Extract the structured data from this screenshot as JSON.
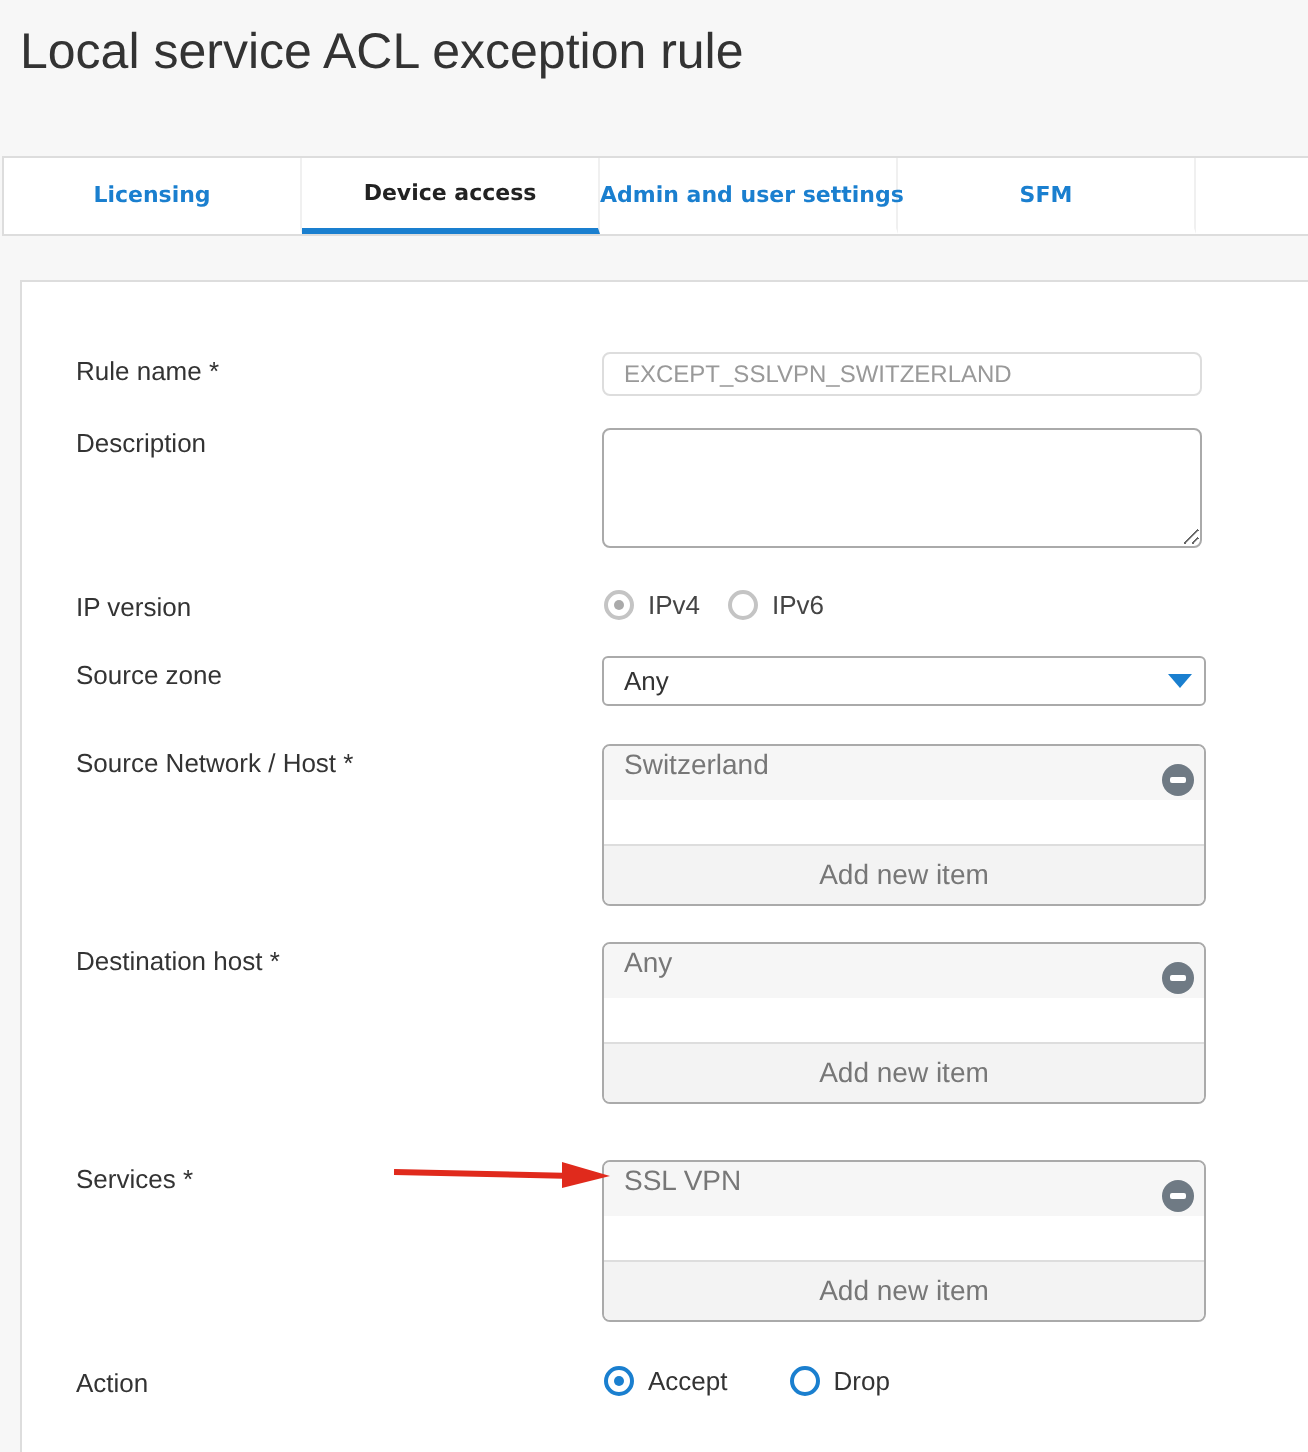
{
  "page_title": "Local service ACL exception rule",
  "tabs": [
    {
      "label": "Licensing",
      "selected": false
    },
    {
      "label": "Device access",
      "selected": true
    },
    {
      "label": "Admin and user settings",
      "selected": false
    },
    {
      "label": "SFM",
      "selected": false
    }
  ],
  "form": {
    "fields": [
      {
        "kind": "text",
        "label": "Rule name *",
        "value": "EXCEPT_SSLVPN_SWITZERLAND",
        "disabled": true
      },
      {
        "kind": "textarea",
        "label": "Description"
      },
      {
        "kind": "radio",
        "label": "IP version",
        "disabled": true,
        "options": [
          {
            "label": "IPv4",
            "selected": true
          },
          {
            "label": "IPv6",
            "selected": false
          }
        ]
      },
      {
        "kind": "select",
        "label": "Source zone",
        "value": "Any"
      },
      {
        "kind": "list",
        "label": "Source Network / Host *",
        "items": [
          "Switzerland"
        ],
        "add_label": "Add new item",
        "arrow": false
      },
      {
        "kind": "list",
        "label": "Destination host *",
        "items": [
          "Any"
        ],
        "add_label": "Add new item",
        "arrow": false
      },
      {
        "kind": "list",
        "label": "Services *",
        "items": [
          "SSL VPN"
        ],
        "add_label": "Add new item",
        "arrow": true
      },
      {
        "kind": "radio",
        "label": "Action",
        "disabled": false,
        "options": [
          {
            "label": "Accept",
            "selected": true
          },
          {
            "label": "Drop",
            "selected": false
          }
        ]
      }
    ]
  }
}
